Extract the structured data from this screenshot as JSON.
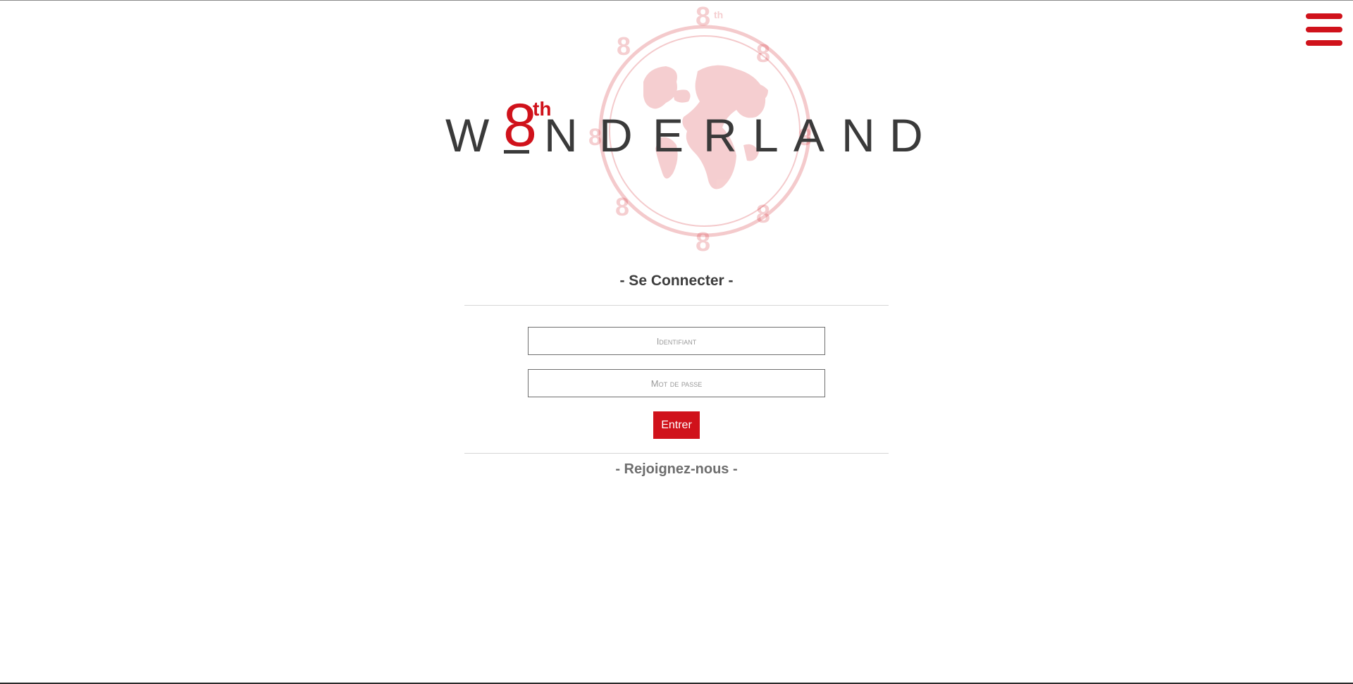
{
  "header": {
    "menu_icon": "hamburger-icon",
    "brand_color": "#d0121b"
  },
  "logo": {
    "emblem_icon": "globe-emblem",
    "number": "8",
    "superscript": "th",
    "wordmark_letters": [
      "W",
      "N",
      "D",
      "E",
      "R",
      "L",
      "A",
      "N",
      "D"
    ],
    "emblem_labels": [
      "8",
      "th"
    ]
  },
  "login": {
    "title": "- Se Connecter -",
    "username_placeholder": "Identifiant",
    "password_placeholder": "Mot de passe",
    "submit_label": "Entrer",
    "join_link": "- Rejoignez-nous -"
  }
}
